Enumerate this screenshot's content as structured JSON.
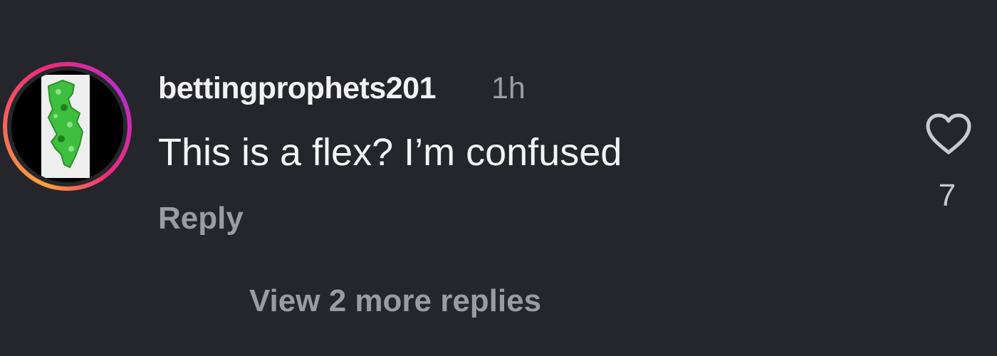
{
  "comment": {
    "username": "bettingprophets201",
    "time": "1h",
    "text": "This is a flex? I’m confused",
    "reply_label": "Reply",
    "view_more_label": "View 2 more replies",
    "like_count": "7",
    "like_icon": "heart-outline-icon",
    "avatar_icon": "new-jersey-map-icon"
  },
  "colors": {
    "background": "#25262b",
    "primary_text": "#f2f2f2",
    "secondary_text": "#9a9ca3",
    "avatar_green": "#3fbf3f"
  }
}
